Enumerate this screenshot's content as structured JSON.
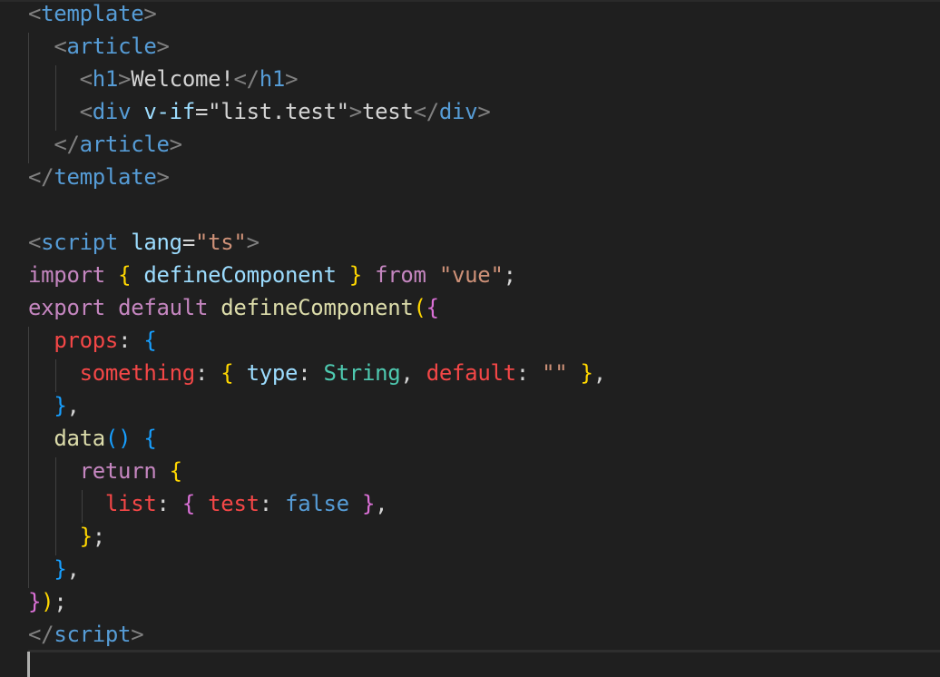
{
  "editor": {
    "language": "vue",
    "cursor_line": 21,
    "colors": {
      "background": "#1f1f1f",
      "tag": "#569cd6",
      "string": "#ce9178",
      "keyword": "#c586c0",
      "function": "#dcdcaa",
      "property_red": "#f44747",
      "type": "#4ec9b0",
      "bracket_gold": "#ffd700",
      "bracket_purple": "#da70d6",
      "bracket_blue": "#179fff"
    },
    "lines": [
      [
        [
          "c-punct",
          "<"
        ],
        [
          "c-tag",
          "template"
        ],
        [
          "c-punct",
          ">"
        ]
      ],
      [
        [
          "c-text",
          "  "
        ],
        [
          "c-punct",
          "<"
        ],
        [
          "c-tag",
          "article"
        ],
        [
          "c-punct",
          ">"
        ]
      ],
      [
        [
          "c-text",
          "    "
        ],
        [
          "c-punct",
          "<"
        ],
        [
          "c-tag",
          "h1"
        ],
        [
          "c-punct",
          ">"
        ],
        [
          "c-text",
          "Welcome!"
        ],
        [
          "c-punct",
          "</"
        ],
        [
          "c-tag",
          "h1"
        ],
        [
          "c-punct",
          ">"
        ]
      ],
      [
        [
          "c-text",
          "    "
        ],
        [
          "c-punct",
          "<"
        ],
        [
          "c-tag",
          "div"
        ],
        [
          "c-text",
          " "
        ],
        [
          "c-attr",
          "v-if"
        ],
        [
          "c-text",
          "=\""
        ],
        [
          "c-text",
          "list.test"
        ],
        [
          "c-text",
          "\""
        ],
        [
          "c-punct",
          ">"
        ],
        [
          "c-text",
          "test"
        ],
        [
          "c-punct",
          "</"
        ],
        [
          "c-tag",
          "div"
        ],
        [
          "c-punct",
          ">"
        ]
      ],
      [
        [
          "c-text",
          "  "
        ],
        [
          "c-punct",
          "</"
        ],
        [
          "c-tag",
          "article"
        ],
        [
          "c-punct",
          ">"
        ]
      ],
      [
        [
          "c-punct",
          "</"
        ],
        [
          "c-tag",
          "template"
        ],
        [
          "c-punct",
          ">"
        ]
      ],
      [],
      [
        [
          "c-punct",
          "<"
        ],
        [
          "c-tag",
          "script"
        ],
        [
          "c-text",
          " "
        ],
        [
          "c-attr",
          "lang"
        ],
        [
          "c-op",
          "="
        ],
        [
          "c-str",
          "\"ts\""
        ],
        [
          "c-punct",
          ">"
        ]
      ],
      [
        [
          "c-kw",
          "import"
        ],
        [
          "c-text",
          " "
        ],
        [
          "c-b1",
          "{"
        ],
        [
          "c-text",
          " "
        ],
        [
          "c-var",
          "defineComponent"
        ],
        [
          "c-text",
          " "
        ],
        [
          "c-b1",
          "}"
        ],
        [
          "c-text",
          " "
        ],
        [
          "c-kw",
          "from"
        ],
        [
          "c-text",
          " "
        ],
        [
          "c-str",
          "\"vue\""
        ],
        [
          "c-op",
          ";"
        ]
      ],
      [
        [
          "c-kw",
          "export"
        ],
        [
          "c-text",
          " "
        ],
        [
          "c-kw",
          "default"
        ],
        [
          "c-text",
          " "
        ],
        [
          "c-fn",
          "defineComponent"
        ],
        [
          "c-b1",
          "("
        ],
        [
          "c-b2",
          "{"
        ]
      ],
      [
        [
          "c-text",
          "  "
        ],
        [
          "c-prop",
          "props"
        ],
        [
          "c-op",
          ":"
        ],
        [
          "c-text",
          " "
        ],
        [
          "c-b3",
          "{"
        ]
      ],
      [
        [
          "c-text",
          "    "
        ],
        [
          "c-prop",
          "something"
        ],
        [
          "c-op",
          ":"
        ],
        [
          "c-text",
          " "
        ],
        [
          "c-b1",
          "{"
        ],
        [
          "c-text",
          " "
        ],
        [
          "c-var",
          "type"
        ],
        [
          "c-op",
          ":"
        ],
        [
          "c-text",
          " "
        ],
        [
          "c-type",
          "String"
        ],
        [
          "c-op",
          ","
        ],
        [
          "c-text",
          " "
        ],
        [
          "c-prop",
          "default"
        ],
        [
          "c-op",
          ":"
        ],
        [
          "c-text",
          " "
        ],
        [
          "c-str",
          "\"\""
        ],
        [
          "c-text",
          " "
        ],
        [
          "c-b1",
          "}"
        ],
        [
          "c-op",
          ","
        ]
      ],
      [
        [
          "c-text",
          "  "
        ],
        [
          "c-b3",
          "}"
        ],
        [
          "c-op",
          ","
        ]
      ],
      [
        [
          "c-text",
          "  "
        ],
        [
          "c-fn",
          "data"
        ],
        [
          "c-b3",
          "()"
        ],
        [
          "c-text",
          " "
        ],
        [
          "c-b3",
          "{"
        ]
      ],
      [
        [
          "c-text",
          "    "
        ],
        [
          "c-kw",
          "return"
        ],
        [
          "c-text",
          " "
        ],
        [
          "c-b1",
          "{"
        ]
      ],
      [
        [
          "c-text",
          "      "
        ],
        [
          "c-prop",
          "list"
        ],
        [
          "c-op",
          ":"
        ],
        [
          "c-text",
          " "
        ],
        [
          "c-b2",
          "{"
        ],
        [
          "c-text",
          " "
        ],
        [
          "c-prop",
          "test"
        ],
        [
          "c-op",
          ":"
        ],
        [
          "c-text",
          " "
        ],
        [
          "c-bool",
          "false"
        ],
        [
          "c-text",
          " "
        ],
        [
          "c-b2",
          "}"
        ],
        [
          "c-op",
          ","
        ]
      ],
      [
        [
          "c-text",
          "    "
        ],
        [
          "c-b1",
          "}"
        ],
        [
          "c-op",
          ";"
        ]
      ],
      [
        [
          "c-text",
          "  "
        ],
        [
          "c-b3",
          "}"
        ],
        [
          "c-op",
          ","
        ]
      ],
      [
        [
          "c-b2",
          "}"
        ],
        [
          "c-b1",
          ")"
        ],
        [
          "c-op",
          ";"
        ]
      ],
      [
        [
          "c-punct",
          "</"
        ],
        [
          "c-tag",
          "script"
        ],
        [
          "c-punct",
          ">"
        ]
      ],
      []
    ]
  }
}
